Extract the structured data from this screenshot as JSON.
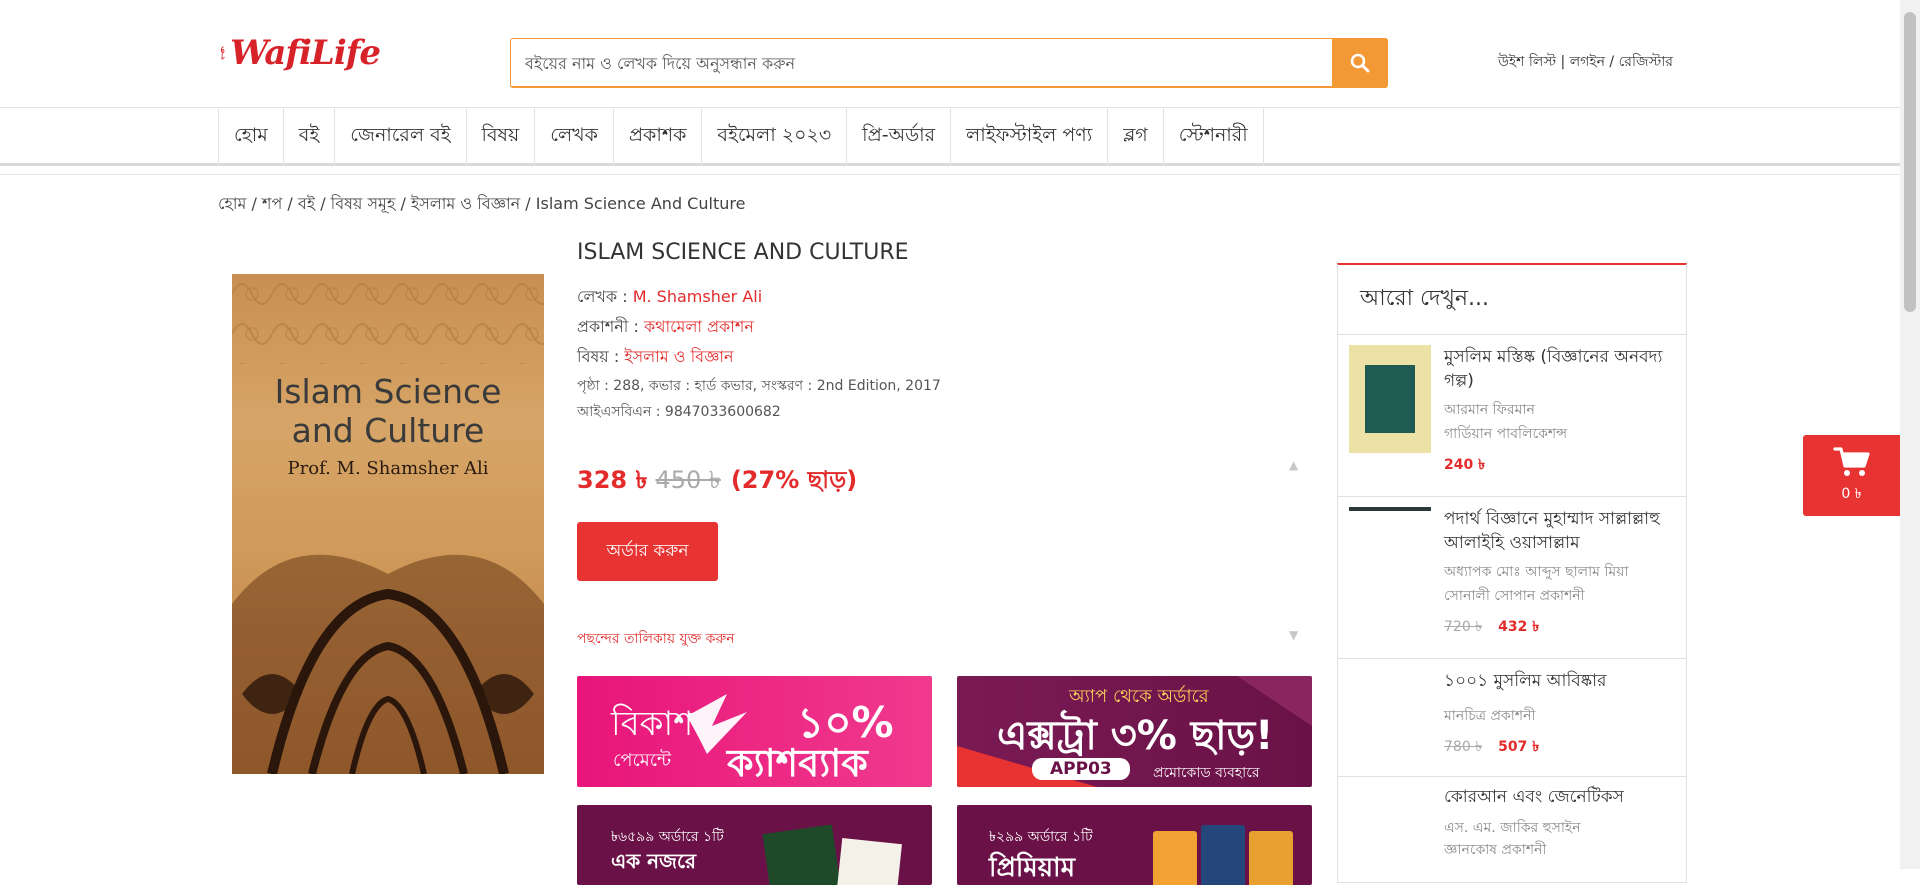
{
  "brand": {
    "logo_text": "WafiLife",
    "color": "#d8222a",
    "accent": "#f29835"
  },
  "search": {
    "placeholder": "বইয়ের নাম ও লেখক দিয়ে অনুসন্ধান করুন",
    "icon": "search-icon"
  },
  "top_links": {
    "wishlist": "উইশ লিস্ট",
    "sep1": " | ",
    "login": "লগইন",
    "sep2": " / ",
    "register": "রেজিস্টার"
  },
  "nav": [
    "হোম",
    "বই",
    "জেনারেল বই",
    "বিষয়",
    "লেখক",
    "প্রকাশক",
    "বইমেলা ২০২৩",
    "প্রি-অর্ডার",
    "লাইফস্টাইল পণ্য",
    "ব্লগ",
    "স্টেশনারী"
  ],
  "breadcrumb": [
    "হোম",
    "শপ",
    "বই",
    "বিষয় সমূহ",
    "ইসলাম ও বিজ্ঞান",
    "Islam Science And Culture"
  ],
  "breadcrumb_sep": " / ",
  "product": {
    "title": "ISLAM SCIENCE AND CULTURE",
    "author_label": "লেখক : ",
    "author": "M. Shamsher Ali",
    "publisher_label": "প্রকাশনী : ",
    "publisher": "কথামেলা প্রকাশন",
    "subject_label": "বিষয় : ",
    "subject": "ইসলাম ও বিজ্ঞান",
    "meta": "পৃষ্ঠা : 288, কভার : হার্ড কভার, সংস্করণ : 2nd Edition, 2017",
    "isbn": "আইএসবিএন : 9847033600682",
    "price_now": "328 ৳",
    "price_old": "450 ৳",
    "discount": "(27% ছাড়)",
    "order_button": "অর্ডার করুন",
    "wishlist": "পছন্দের তালিকায় যুক্ত করুন",
    "cover": {
      "line1": "Islam Science",
      "line2": "and Culture",
      "line3": "Prof. M. Shamsher Ali"
    }
  },
  "banners": {
    "b1": {
      "l1": "বিকাশ",
      "l2": "পেমেন্টে",
      "l3": "১০%",
      "l4": "ক্যাশব্যাক"
    },
    "b2": {
      "l1": "অ্যাপ থেকে অর্ডারে",
      "l2": "এক্সট্রা ৩% ছাড়!",
      "l3": "APP03",
      "l4": "প্রমোকোড ব্যবহারে"
    },
    "b3": {
      "l1": "৳৬৫৯৯ অর্ডারে ১টি",
      "l2": "এক নজরে"
    },
    "b4": {
      "l1": "৳২৯৯ অর্ডারে ১টি",
      "l2": "প্রিমিয়াম"
    }
  },
  "sidebar": {
    "heading": "আরো দেখুন...",
    "items": [
      {
        "title": "মুসলিম মস্তিষ্ক (বিজ্ঞানের অনবদ্য গল্প)",
        "author": "আরমান ফিরমান",
        "publisher": "গার্ডিয়ান পাবলিকেশন্স",
        "old_price": "",
        "price": "240 ৳"
      },
      {
        "title": "পদার্থ বিজ্ঞানে মুহাম্মাদ সাল্লাল্লাহু আলাইহি ওয়াসাল্লাম",
        "author": "অধ্যাপক মোঃ আব্দুস ছালাম মিয়া",
        "publisher": "সোনালী সোপান প্রকাশনী",
        "old_price": "720 ৳",
        "price": "432 ৳"
      },
      {
        "title": "১০০১ মুসলিম আবিষ্কার",
        "author": "মানচিত্র প্রকাশনী",
        "publisher": "",
        "old_price": "780 ৳",
        "price": "507 ৳"
      },
      {
        "title": "কোরআন এবং জেনেটিকস",
        "author": "এস. এম. জাকির হুসাইন",
        "publisher": "জ্ঞানকোষ প্রকাশনী",
        "old_price": "",
        "price": ""
      }
    ]
  },
  "cart": {
    "amount": "0 ৳",
    "icon": "cart-icon"
  }
}
